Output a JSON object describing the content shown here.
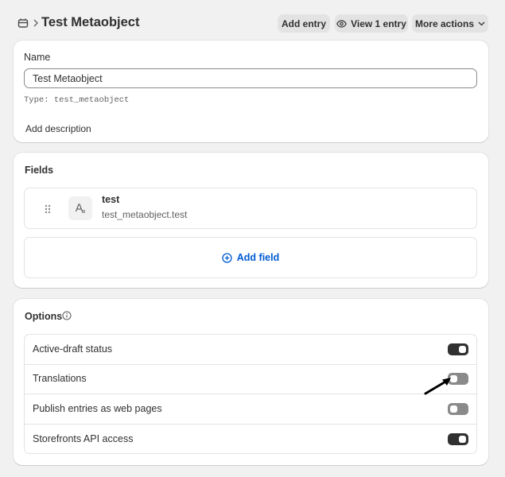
{
  "header": {
    "title": "Test Metaobject",
    "actions": {
      "add_entry": "Add entry",
      "view_entries": "View 1 entry",
      "more_actions": "More actions"
    }
  },
  "name_card": {
    "label": "Name",
    "value": "Test Metaobject",
    "type_prefix": "Type:",
    "type_handle": "test_metaobject",
    "add_description": "Add description"
  },
  "fields_card": {
    "heading": "Fields",
    "fields": [
      {
        "name": "test",
        "key": "test_metaobject.test"
      }
    ],
    "add_field": "Add field"
  },
  "options_card": {
    "heading": "Options",
    "options": [
      {
        "label": "Active-draft status",
        "enabled": true
      },
      {
        "label": "Translations",
        "enabled": false
      },
      {
        "label": "Publish entries as web pages",
        "enabled": false
      },
      {
        "label": "Storefronts API access",
        "enabled": true
      }
    ]
  },
  "colors": {
    "page_bg": "#f1f1f1",
    "card_bg": "#ffffff",
    "text": "#303030",
    "link_blue": "#005bd3",
    "toggle_on": "#303030",
    "toggle_off": "#8a8a8a"
  },
  "icons": {
    "breadcrumb": "metaobject-icon",
    "view": "eye-icon",
    "more": "chevron-down-icon",
    "drag": "drag-handle-icon",
    "field_type": "text-field-icon",
    "add": "plus-circle-icon",
    "info": "info-icon"
  }
}
